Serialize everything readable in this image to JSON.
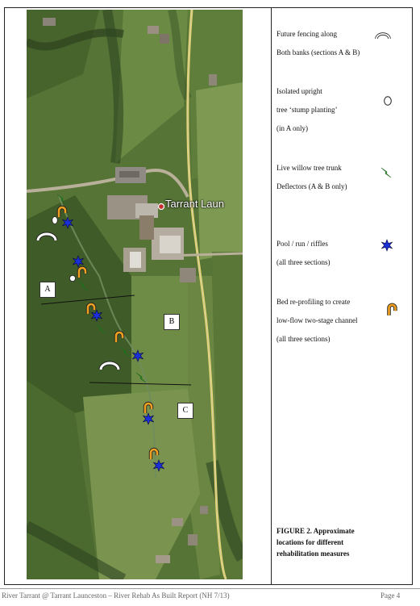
{
  "map": {
    "place_label": "Tarrant Laun",
    "section_labels": [
      "A",
      "B",
      "C"
    ]
  },
  "legend": {
    "fencing": {
      "line1": "Future fencing along",
      "line2": "Both banks (sections A & B)",
      "icon": "fence-arc-icon"
    },
    "stump": {
      "line1": "Isolated upright",
      "line2": "tree ‘stump planting’",
      "line3": "(in A only)",
      "icon": "circle-outline-icon"
    },
    "willow": {
      "line1": "Live willow tree trunk",
      "line2": "Deflectors (A & B only)",
      "icon": "lightning-bolt-icon"
    },
    "pool": {
      "line1": "Pool / run / riffles",
      "line2": "(all three sections)",
      "icon": "blue-star-icon"
    },
    "bed": {
      "line1": "Bed re-profiling to create",
      "line2": "low-flow two-stage channel",
      "line3": "(all three sections)",
      "icon": "hook-icon"
    }
  },
  "caption": {
    "line1": "FIGURE 2.  Approximate",
    "line2": "locations for different",
    "line3": "rehabilitation  measures"
  },
  "footer": {
    "left": "River Tarrant @ Tarrant Launceston  – River Rehab As Built Report (NH 7/13)",
    "right": "Page 4"
  },
  "colors": {
    "willow_green": "#3fbf3f",
    "star_blue": "#1a2fd6",
    "hook_orange": "#f0a020",
    "road_yellow": "#e8d86a"
  }
}
